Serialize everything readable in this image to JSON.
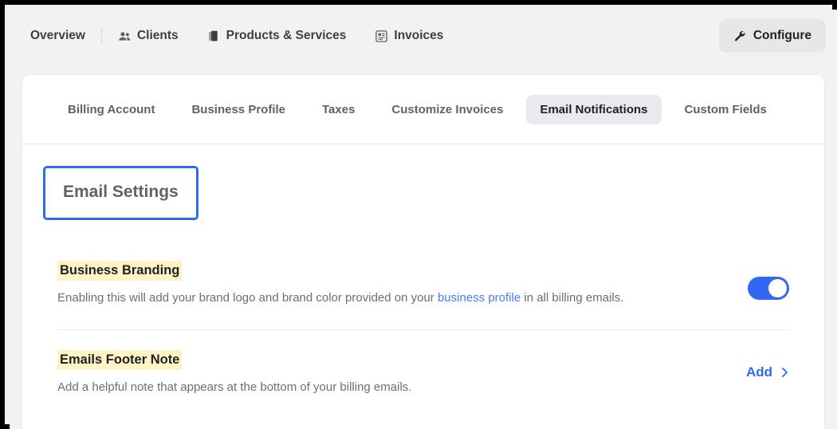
{
  "topnav": {
    "items": [
      {
        "label": "Overview",
        "icon": ""
      },
      {
        "label": "Clients",
        "icon": "people-icon"
      },
      {
        "label": "Products & Services",
        "icon": "products-box-icon"
      },
      {
        "label": "Invoices",
        "icon": "invoice-document-icon"
      }
    ],
    "configure": {
      "label": "Configure",
      "icon": "wrench-icon"
    }
  },
  "tabs": [
    {
      "label": "Billing Account",
      "active": false
    },
    {
      "label": "Business Profile",
      "active": false
    },
    {
      "label": "Taxes",
      "active": false
    },
    {
      "label": "Customize Invoices",
      "active": false
    },
    {
      "label": "Email Notifications",
      "active": true
    },
    {
      "label": "Custom Fields",
      "active": false
    }
  ],
  "section": {
    "title": "Email Settings"
  },
  "settings": {
    "branding": {
      "label": "Business Branding",
      "desc_before": "Enabling this will add your brand logo and brand color provided on your ",
      "link_text": "business profile",
      "desc_after": " in all billing emails.",
      "toggle_state": "on"
    },
    "footer_note": {
      "label": "Emails Footer Note",
      "desc": "Add a helpful note that appears at the bottom of your billing emails.",
      "action_label": "Add",
      "action_icon": "chevron-right-icon"
    }
  },
  "colors": {
    "accent_blue": "#3068f3",
    "link_blue": "#4a7df5",
    "highlight_yellow": "#fdf3c4",
    "focus_ring": "#2b6cf0",
    "page_bg": "#f1f2f2"
  }
}
